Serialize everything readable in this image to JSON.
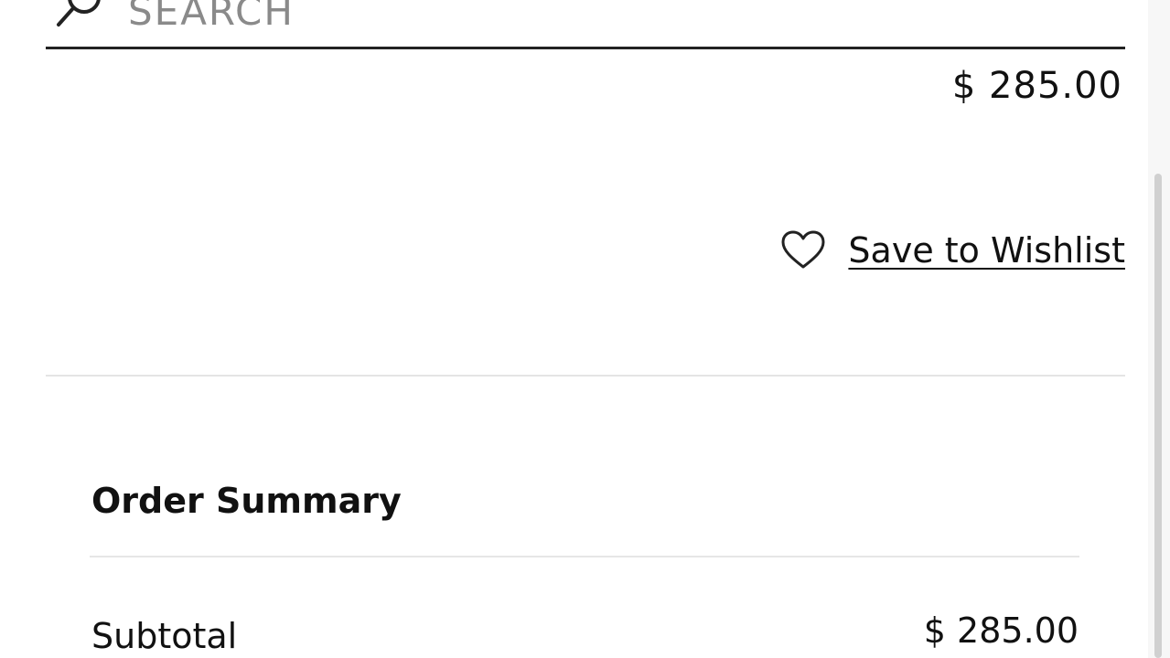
{
  "search": {
    "placeholder": "SEARCH"
  },
  "cart_item": {
    "price": "$ 285.00",
    "wishlist_label": "Save to Wishlist"
  },
  "order_summary": {
    "title": "Order Summary",
    "subtotal_label": "Subtotal",
    "subtotal_value": "$ 285.00"
  },
  "icons": {
    "search": "search-icon",
    "wishlist": "heart-icon"
  }
}
